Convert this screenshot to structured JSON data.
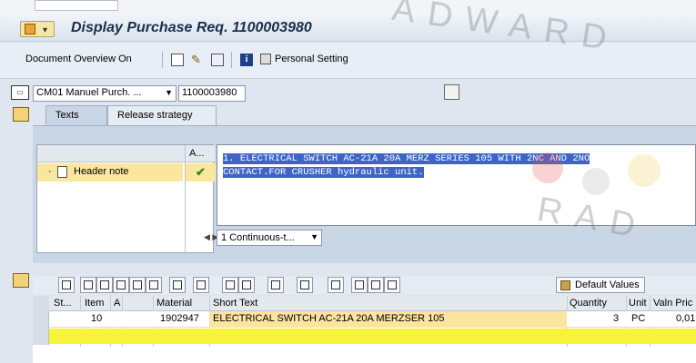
{
  "window": {
    "title": "Display Purchase Req. 1100003980"
  },
  "toolbar": {
    "doc_overview": "Document Overview On",
    "personal_setting": "Personal Setting"
  },
  "header": {
    "doc_type_select": "CM01 Manuel Purch. ...",
    "doc_number": "1100003980"
  },
  "tabs": [
    "Texts",
    "Release strategy"
  ],
  "texts": {
    "tree_col_a": "A...",
    "header_note_label": "Header note",
    "editor_line1": "1. ELECTRICAL SWITCH AC-21A 20A MERZ SERIES 105 WITH 2NC AND 2NO",
    "editor_line2": "CONTACT.FOR CRUSHER hydraulic unit.",
    "format_select": "1 Continuous-t..."
  },
  "grid_toolbar": {
    "default_values": "Default Values"
  },
  "items_table": {
    "headers": [
      "St...",
      "Item",
      "A",
      "Material",
      "Short Text",
      "Quantity",
      "Unit",
      "Valn Pric"
    ],
    "rows": [
      {
        "item": "10",
        "material": "1902947",
        "short_text": "ELECTRICAL SWITCH AC-21A 20A MERZSER 105",
        "quantity": "3",
        "unit": "PC",
        "price": "0,01"
      }
    ]
  },
  "watermark": {
    "text1": "ADWARD",
    "text2": "RAD"
  },
  "colors": {
    "accent": "#3e64c8",
    "highlight_row": "#f7f23b",
    "selected_row": "#fbe69e"
  }
}
